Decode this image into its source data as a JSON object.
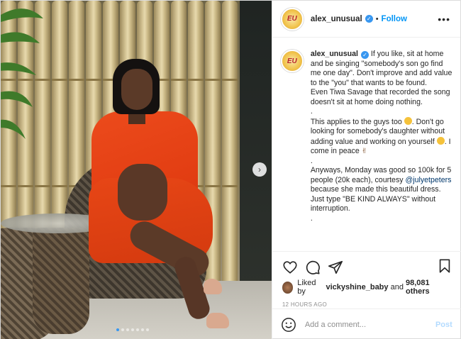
{
  "post": {
    "username": "alex_unusual",
    "verified": true,
    "follow_label": "Follow",
    "separator": "•",
    "more_icon": "more-options-icon",
    "avatar_text": "EU",
    "caption_lines": [
      "If you like, sit at home and be singing \"somebody's son go find me one day\". Don't improve and add value to the \"you\" that wants to be found.",
      "Even Tiwa Savage that recorded the song doesn't sit at home doing nothing.",
      ".",
      "This applies to the guys too",
      ". Don't go looking for somebody's daughter without adding value and working on yourself",
      ". I come in peace",
      ".",
      "Anyways, Monday was good so 100k for 5 people (20k each), courtesy",
      "@julyetpeters",
      "because she made this beautiful dress. Just type \"BE KIND ALWAYS\" without interruption.",
      "."
    ],
    "liked_by_prefix": "Liked by",
    "liked_by_user": "vickyshine_baby",
    "liked_by_and": "and",
    "liked_by_others": "98,081 others",
    "timestamp": "12 HOURS AGO",
    "comment_placeholder": "Add a comment...",
    "post_button": "Post",
    "carousel": {
      "slides": 7,
      "active_index": 0
    },
    "accent_color": "#0095f6",
    "icons": [
      "heart-icon",
      "comment-icon",
      "share-icon",
      "bookmark-icon",
      "emoji-icon",
      "next-arrow-icon"
    ]
  }
}
